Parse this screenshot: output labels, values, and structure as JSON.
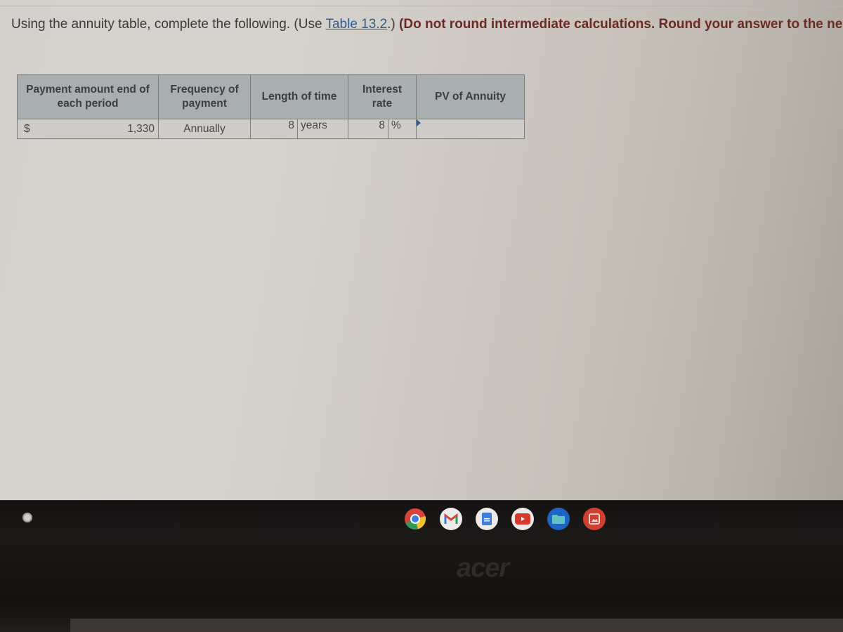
{
  "question": {
    "intro": "Using the annuity table, complete the following. (Use ",
    "link_text": "Table 13.2",
    "after_link": ".) ",
    "instruction": "(Do not round intermediate calculations. Round your answer to the nearest cent.)"
  },
  "table": {
    "headers": {
      "payment": "Payment amount end of each period",
      "frequency": "Frequency of payment",
      "length": "Length of time",
      "interest": "Interest rate",
      "pv": "PV of Annuity"
    },
    "row": {
      "currency_symbol": "$",
      "payment_amount": "1,330",
      "frequency": "Annually",
      "length_value": "8",
      "length_unit": "years",
      "interest_value": "8",
      "interest_unit": "%",
      "pv_value": ""
    }
  },
  "shelf": {
    "apps": [
      "chrome-icon",
      "gmail-icon",
      "docs-icon",
      "youtube-icon",
      "files-icon",
      "gallery-icon"
    ]
  },
  "bezel": {
    "brand": "acer"
  }
}
